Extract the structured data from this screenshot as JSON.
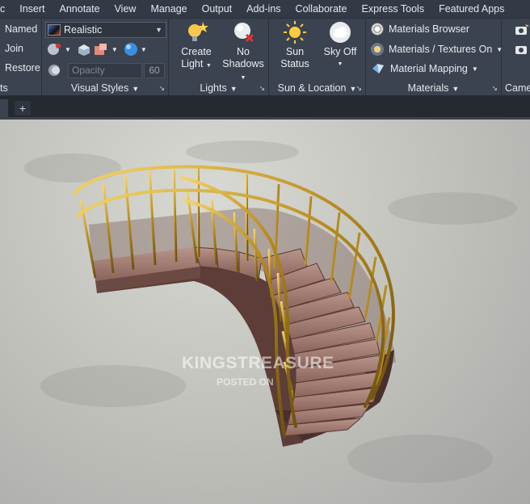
{
  "menu": {
    "tabs": [
      "c",
      "Insert",
      "Annotate",
      "View",
      "Manage",
      "Output",
      "Add-ins",
      "Collaborate",
      "Express Tools",
      "Featured Apps"
    ]
  },
  "ribbon": {
    "views": {
      "named": "Named",
      "join": "Join",
      "restore": "Restore",
      "label": "ts"
    },
    "visual_styles": {
      "current": "Realistic",
      "opacity_placeholder": "Opacity",
      "opacity_value": "60",
      "label": "Visual Styles"
    },
    "lights": {
      "create_light": [
        "Create",
        "Light"
      ],
      "no_shadows": [
        "No",
        "Shadows"
      ],
      "label": "Lights"
    },
    "sun_location": {
      "sun_status": [
        "Sun",
        "Status"
      ],
      "sky_off": "Sky Off",
      "label": "Sun & Location"
    },
    "materials": {
      "browser": "Materials Browser",
      "textures": "Materials / Textures On",
      "mapping": "Material Mapping",
      "label": "Materials"
    },
    "camera": {
      "label": "Camer"
    }
  },
  "viewport": {
    "watermark": "KINGSTREASURE",
    "watermark_sub": "POSTED ON"
  }
}
